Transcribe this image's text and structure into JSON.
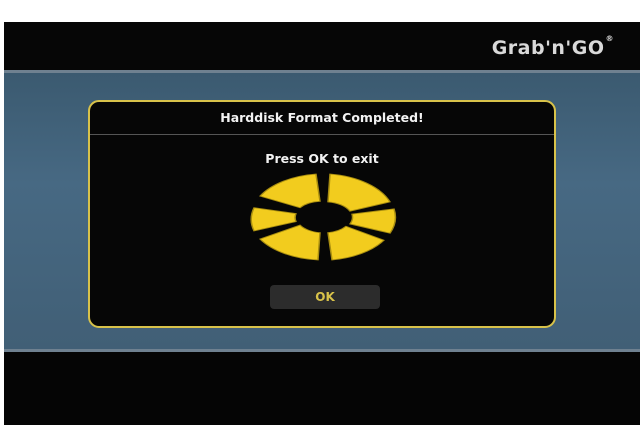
{
  "header": {
    "brand": "Grab'n'GO",
    "brand_mark": "®"
  },
  "dialog": {
    "title": "Harddisk Format Completed!",
    "message": "Press OK to exit",
    "ok_label": "OK",
    "icon": "busy-spinner-icon"
  },
  "colors": {
    "accent": "#d8c24a",
    "spinner_active": "#f2cc1e",
    "background_band": "#476983",
    "screen": "#050505"
  }
}
